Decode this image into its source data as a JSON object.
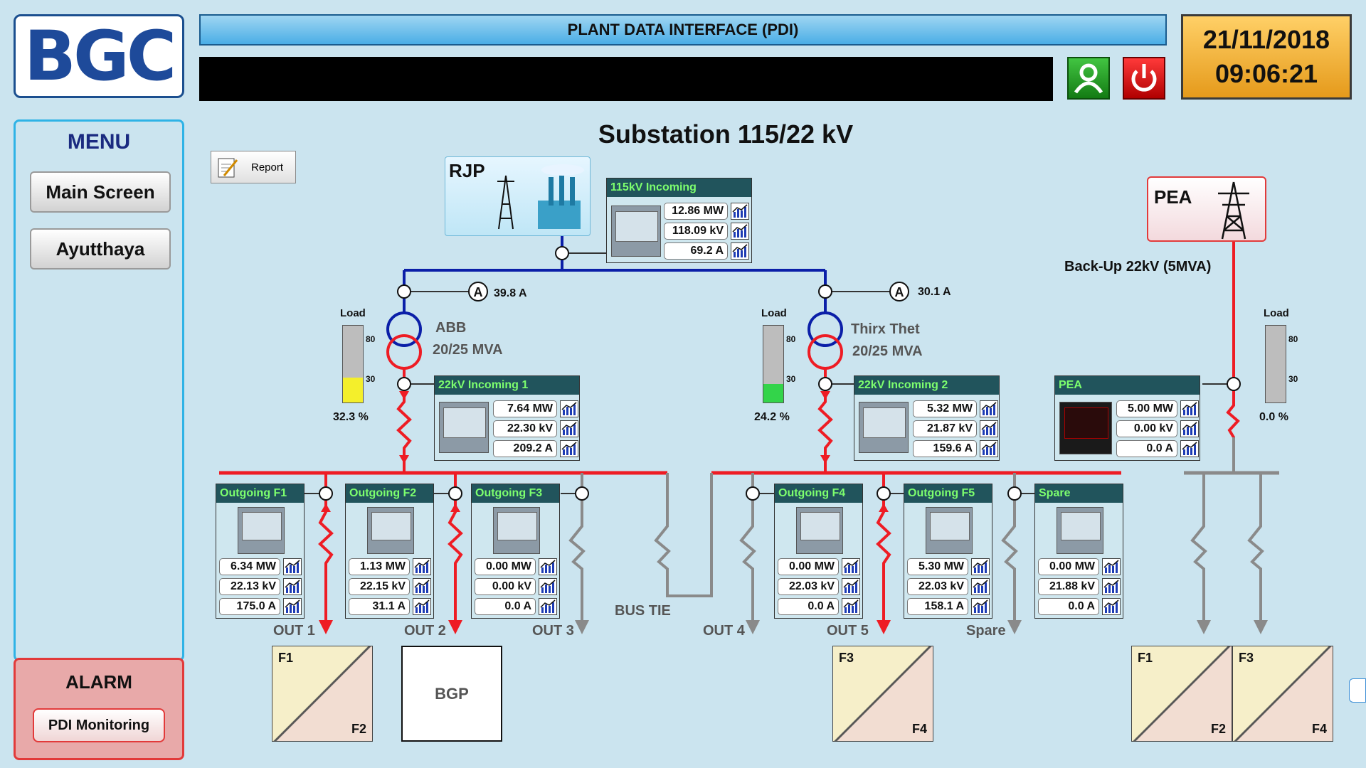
{
  "header": {
    "logo": "BGC",
    "title": "PLANT DATA INTERFACE (PDI)",
    "date": "21/11/2018",
    "time": "09:06:21"
  },
  "menu": {
    "title": "MENU",
    "items": [
      "Main Screen",
      "Ayutthaya"
    ]
  },
  "alarm": {
    "title": "ALARM",
    "button": "PDI Monitoring"
  },
  "page_title": "Substation 115/22 kV",
  "report_label": "Report",
  "sources": {
    "rjp": "RJP",
    "pea": "PEA",
    "backup_label": "Back-Up 22kV (5MVA)"
  },
  "transformers": [
    {
      "name": "ABB",
      "rating": "20/25 MVA",
      "current": "39.8 A",
      "load_label": "Load",
      "load_value": "32.3 %",
      "load_percent": 32.3,
      "fill_color": "#f4ef2b"
    },
    {
      "name": "Thirx Thet",
      "rating": "20/25 MVA",
      "current": "30.1 A",
      "load_label": "Load",
      "load_value": "24.2 %",
      "load_percent": 24.2,
      "fill_color": "#33d44a"
    }
  ],
  "pea_load": {
    "label": "Load",
    "value": "0.0 %",
    "percent": 0
  },
  "gauge_ticks": [
    "80",
    "30"
  ],
  "ammeter_symbol": "A",
  "meters": {
    "incoming115": {
      "title": "115kV Incoming",
      "mw": "12.86 MW",
      "kv": "118.09 kV",
      "a": "69.2 A"
    },
    "incoming1": {
      "title": "22kV Incoming 1",
      "mw": "7.64 MW",
      "kv": "22.30 kV",
      "a": "209.2 A"
    },
    "incoming2": {
      "title": "22kV Incoming 2",
      "mw": "5.32 MW",
      "kv": "21.87 kV",
      "a": "159.6 A"
    },
    "pea": {
      "title": "PEA",
      "mw": "5.00 MW",
      "kv": "0.00 kV",
      "a": "0.0 A"
    },
    "f1": {
      "title": "Outgoing F1",
      "mw": "6.34 MW",
      "kv": "22.13 kV",
      "a": "175.0 A"
    },
    "f2": {
      "title": "Outgoing F2",
      "mw": "1.13 MW",
      "kv": "22.15 kV",
      "a": "31.1 A"
    },
    "f3": {
      "title": "Outgoing F3",
      "mw": "0.00 MW",
      "kv": "0.00 kV",
      "a": "0.0 A"
    },
    "f4": {
      "title": "Outgoing F4",
      "mw": "0.00 MW",
      "kv": "22.03 kV",
      "a": "0.0 A"
    },
    "f5": {
      "title": "Outgoing F5",
      "mw": "5.30 MW",
      "kv": "22.03 kV",
      "a": "158.1 A"
    },
    "spare": {
      "title": "Spare",
      "mw": "0.00 MW",
      "kv": "21.88 kV",
      "a": "0.0 A"
    }
  },
  "outputs": [
    "OUT 1",
    "OUT 2",
    "OUT 3",
    "OUT 4",
    "OUT 5",
    "Spare"
  ],
  "bus_tie": "BUS TIE",
  "loads": {
    "bgp": "BGP",
    "plant1": [
      "F1",
      "F2"
    ],
    "plant2": [
      "F3",
      "F4"
    ],
    "plant3": [
      "F1",
      "F2"
    ],
    "plant4": [
      "F3",
      "F4"
    ]
  },
  "colors": {
    "hv_bus": "#0b1fa8",
    "energized": "#ee1c24",
    "deenergized": "#8a8a8a",
    "meter_header": "#21545c",
    "meter_title": "#7dff6e"
  }
}
